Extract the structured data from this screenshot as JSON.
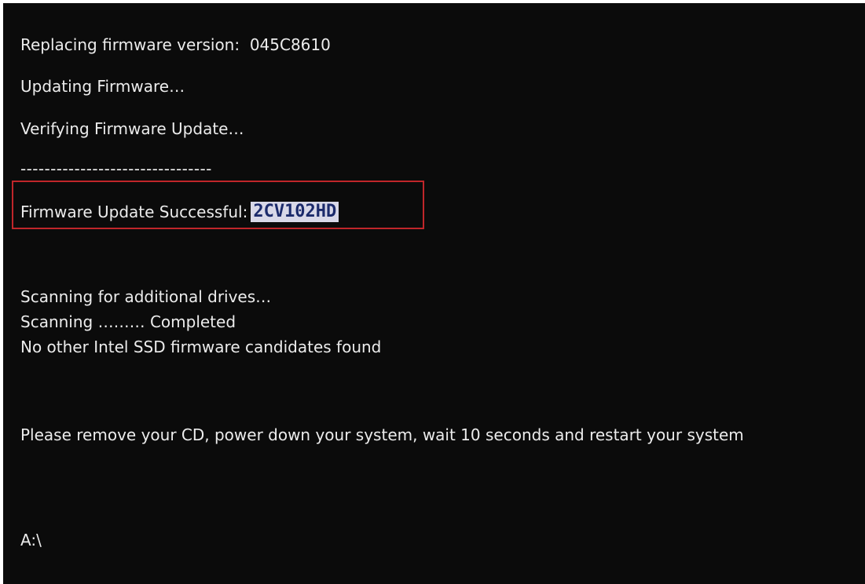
{
  "console": {
    "replacing_label": "Replacing firmware version:",
    "replacing_version": "045C8610",
    "updating": "Updating Firmware…",
    "verifying": "Verifying Firmware Update…",
    "separator": "--------------------------------",
    "success_label": "Firmware Update Successful:",
    "success_version": "2CV102HD",
    "scanning_additional": "Scanning for additional drives…",
    "scanning_completed": "Scanning ……… Completed",
    "no_candidates": "No other Intel SSD firmware candidates found",
    "instruction": "Please remove your CD, power down your system, wait 10 seconds and restart your system",
    "prompt": "A:\\"
  },
  "colors": {
    "background": "#0b0b0b",
    "text": "#ececec",
    "highlight_border": "#c0262a",
    "selection_bg": "#d8d8e8",
    "selection_text": "#1b2a6b"
  }
}
